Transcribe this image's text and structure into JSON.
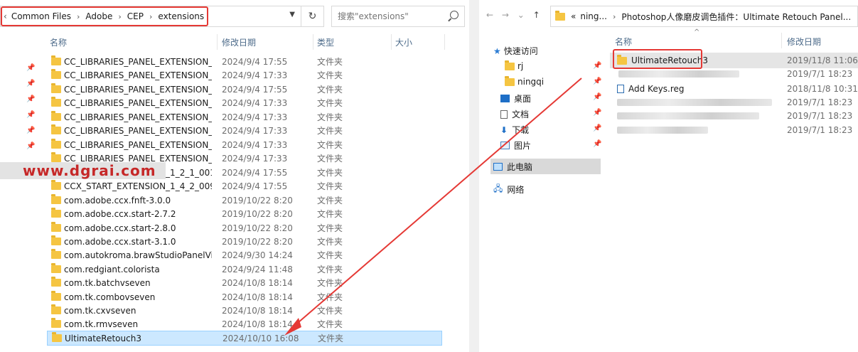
{
  "left": {
    "address": {
      "crumbs": [
        "Common Files",
        "Adobe",
        "CEP",
        "extensions"
      ],
      "back_glyph": "‹",
      "separator": "›"
    },
    "search": {
      "placeholder": "搜索\"extensions\""
    },
    "columns": {
      "name": "名称",
      "date": "修改日期",
      "type": "类型",
      "size": "大小"
    },
    "files": [
      {
        "name": "CC_LIBRARIES_PANEL_EXTENSION_2_...",
        "date": "2024/9/4 17:55",
        "type": "文件夹"
      },
      {
        "name": "CC_LIBRARIES_PANEL_EXTENSION_2_...",
        "date": "2024/9/4 17:33",
        "type": "文件夹"
      },
      {
        "name": "CC_LIBRARIES_PANEL_EXTENSION_2_...",
        "date": "2024/9/4 17:55",
        "type": "文件夹"
      },
      {
        "name": "CC_LIBRARIES_PANEL_EXTENSION_2_...",
        "date": "2024/9/4 17:33",
        "type": "文件夹"
      },
      {
        "name": "CC_LIBRARIES_PANEL_EXTENSION_2_...",
        "date": "2024/9/4 17:33",
        "type": "文件夹"
      },
      {
        "name": "CC_LIBRARIES_PANEL_EXTENSION_2_...",
        "date": "2024/9/4 17:33",
        "type": "文件夹"
      },
      {
        "name": "CC_LIBRARIES_PANEL_EXTENSION_3_...",
        "date": "2024/9/4 17:33",
        "type": "文件夹"
      },
      {
        "name": "CC_LIBRARIES_PANEL_EXTENSION_3_...",
        "date": "2024/9/4 17:33",
        "type": "文件夹"
      },
      {
        "name": "CCX_START_EXTENSION_1_2_1_001",
        "date": "2024/9/4 17:55",
        "type": "文件夹"
      },
      {
        "name": "CCX_START_EXTENSION_1_4_2_009",
        "date": "2024/9/4 17:55",
        "type": "文件夹"
      },
      {
        "name": "com.adobe.ccx.fnft-3.0.0",
        "date": "2019/10/22 8:20",
        "type": "文件夹"
      },
      {
        "name": "com.adobe.ccx.start-2.7.2",
        "date": "2019/10/22 8:20",
        "type": "文件夹"
      },
      {
        "name": "com.adobe.ccx.start-2.8.0",
        "date": "2019/10/22 8:20",
        "type": "文件夹"
      },
      {
        "name": "com.adobe.ccx.start-3.1.0",
        "date": "2019/10/22 8:20",
        "type": "文件夹"
      },
      {
        "name": "com.autokroma.brawStudioPanelVisi...",
        "date": "2024/9/30 14:24",
        "type": "文件夹"
      },
      {
        "name": "com.redgiant.colorista",
        "date": "2024/9/24 11:48",
        "type": "文件夹"
      },
      {
        "name": "com.tk.batchvseven",
        "date": "2024/10/8 18:14",
        "type": "文件夹"
      },
      {
        "name": "com.tk.combovseven",
        "date": "2024/10/8 18:14",
        "type": "文件夹"
      },
      {
        "name": "com.tk.cxvseven",
        "date": "2024/10/8 18:14",
        "type": "文件夹"
      },
      {
        "name": "com.tk.rmvseven",
        "date": "2024/10/8 18:14",
        "type": "文件夹"
      },
      {
        "name": "UltimateRetouch3",
        "date": "2024/10/10 16:08",
        "type": "文件夹"
      }
    ],
    "watermark": "www.dgrai.com"
  },
  "right": {
    "nav": {
      "back": "←",
      "forward": "→",
      "down": "⌄",
      "up": "↑"
    },
    "address": {
      "prefix": "«",
      "crumbs": [
        "ning...",
        "Photoshop人像磨皮调色插件：Ultimate Retouch Panel..."
      ],
      "separator": "›"
    },
    "columns": {
      "name": "名称",
      "date": "修改日期"
    },
    "tree": [
      {
        "label": "快速访问",
        "icon": "star-icon"
      },
      {
        "label": "rj",
        "icon": "folder-icon"
      },
      {
        "label": "ningqi",
        "icon": "folder-icon"
      },
      {
        "label": "桌面",
        "icon": "desktop-icon"
      },
      {
        "label": "文档",
        "icon": "document-icon"
      },
      {
        "label": "下载",
        "icon": "download-icon"
      },
      {
        "label": "图片",
        "icon": "picture-icon"
      },
      {
        "label": "此电脑",
        "icon": "computer-icon"
      },
      {
        "label": "网络",
        "icon": "network-icon"
      }
    ],
    "files": [
      {
        "name": "UltimateRetouch3",
        "date": "2019/11/8 11:06"
      },
      {
        "name": "",
        "date": "2019/7/1 18:23"
      },
      {
        "name": "Add Keys.reg",
        "date": "2018/11/8 10:31"
      },
      {
        "name": "",
        "date": "2019/7/1 18:23"
      },
      {
        "name": "",
        "date": "2019/7/1 18:23"
      },
      {
        "name": "",
        "date": "2019/7/1 18:23"
      }
    ]
  },
  "colors": {
    "highlight_red": "#e53935",
    "selection_blue": "#cce8ff",
    "folder_yellow": "#f5c542"
  }
}
